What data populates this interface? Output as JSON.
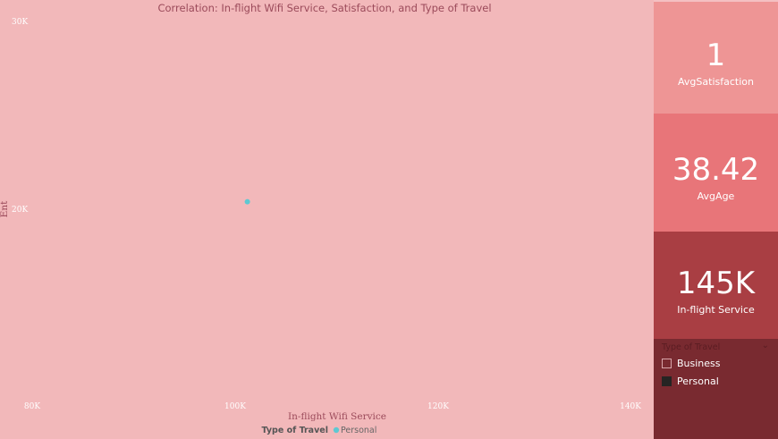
{
  "chart_data": {
    "type": "scatter",
    "title": "Correlation: In-flight Wifi Service, Satisfaction, and Type of Travel",
    "xlabel": "In-flight Wifi Service",
    "ylabel": "Ent",
    "xlim": [
      80000,
      140000
    ],
    "ylim": [
      10000,
      30000
    ],
    "x_ticks": [
      80000,
      100000,
      120000,
      140000
    ],
    "x_tick_labels": [
      "80K",
      "100K",
      "120K",
      "140K"
    ],
    "y_ticks": [
      30000,
      20000
    ],
    "y_tick_labels": [
      "30K",
      "20K"
    ],
    "legend": {
      "title": "Type of Travel",
      "position": "bottom-center"
    },
    "series": [
      {
        "name": "Personal",
        "color": "#5ec8d2",
        "points": [
          {
            "x": 101200,
            "y": 20400
          }
        ]
      }
    ]
  },
  "cards": [
    {
      "value": "1",
      "label": "AvgSatisfaction"
    },
    {
      "value": "38.42",
      "label": "AvgAge"
    },
    {
      "value": "145K",
      "label": "In-flight Service"
    }
  ],
  "slicer": {
    "title": "Type of Travel",
    "options": [
      {
        "label": "Business",
        "checked": false
      },
      {
        "label": "Personal",
        "checked": true
      }
    ]
  },
  "colors": {
    "background": "#f2b8ba",
    "card_1": "#ee9595",
    "card_2": "#e87579",
    "card_3": "#a93e43",
    "slicer_bg": "#792a30",
    "series_personal": "#5ec8d2"
  }
}
